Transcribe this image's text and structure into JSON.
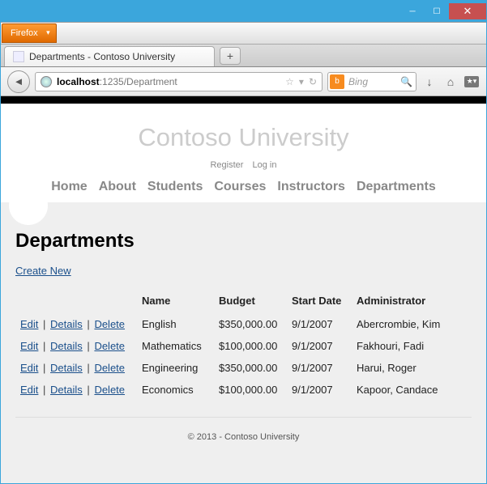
{
  "window": {
    "firefox_label": "Firefox",
    "tab_title": "Departments - Contoso University",
    "new_tab": "+",
    "url_host": "localhost",
    "url_path": ":1235/Department",
    "search_placeholder": "Bing",
    "star": "☆",
    "dropdown": "▾",
    "reload": "↻",
    "provider": "b",
    "magnify": "🔍",
    "download": "↓",
    "home": "⌂",
    "bookmark": "★"
  },
  "page": {
    "site_title": "Contoso University",
    "register": "Register",
    "login": "Log in",
    "nav": [
      "Home",
      "About",
      "Students",
      "Courses",
      "Instructors",
      "Departments"
    ],
    "heading": "Departments",
    "create_new": "Create New",
    "columns": {
      "name": "Name",
      "budget": "Budget",
      "start": "Start Date",
      "admin": "Administrator"
    },
    "actions": {
      "edit": "Edit",
      "details": "Details",
      "delete": "Delete",
      "sep": "|"
    },
    "rows": [
      {
        "name": "English",
        "budget": "$350,000.00",
        "start": "9/1/2007",
        "admin": "Abercrombie, Kim"
      },
      {
        "name": "Mathematics",
        "budget": "$100,000.00",
        "start": "9/1/2007",
        "admin": "Fakhouri, Fadi"
      },
      {
        "name": "Engineering",
        "budget": "$350,000.00",
        "start": "9/1/2007",
        "admin": "Harui, Roger"
      },
      {
        "name": "Economics",
        "budget": "$100,000.00",
        "start": "9/1/2007",
        "admin": "Kapoor, Candace"
      }
    ],
    "footer": "© 2013 - Contoso University"
  }
}
